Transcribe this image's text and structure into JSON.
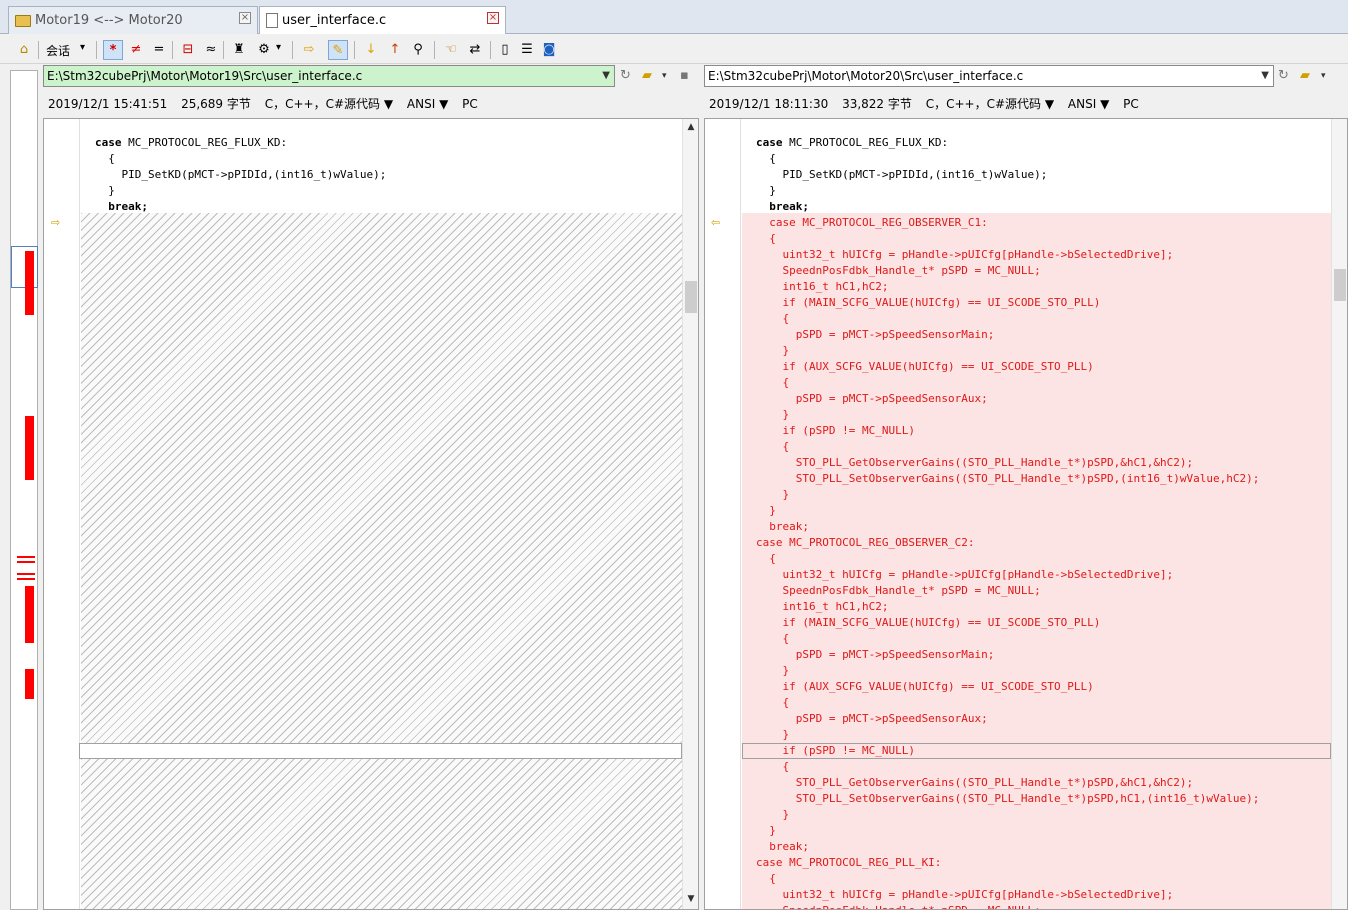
{
  "tabs": [
    {
      "label": "Motor19 <--> Motor20",
      "close": "×"
    },
    {
      "label": "user_interface.c",
      "close": "×"
    }
  ],
  "toolbar": {
    "session_label": "会话",
    "session_arrow": "▾",
    "show_all": "*",
    "show_diff": "≠",
    "show_same": "=",
    "align": "≈"
  },
  "left": {
    "path": "E:\\Stm32cubePrj\\Motor\\Motor19\\Src\\user_interface.c",
    "info": [
      "2019/12/1 15:41:51",
      "25,689 字节",
      "C，C++，C#源代码 ▼",
      "ANSI ▼",
      "PC"
    ],
    "lines": [
      {
        "t": "case MC_PROTOCOL_REG_FLUX_KD:"
      },
      {
        "t": "  {"
      },
      {
        "t": "    PID_SetKD(pMCT->pPIDId,(int16_t)wValue);"
      },
      {
        "t": "  }"
      },
      {
        "t": "  break;"
      }
    ]
  },
  "right": {
    "path": "E:\\Stm32cubePrj\\Motor\\Motor20\\Src\\user_interface.c",
    "info": [
      "2019/12/1 18:11:30",
      "33,822 字节",
      "C，C++，C#源代码 ▼",
      "ANSI ▼",
      "PC"
    ],
    "lines": [
      {
        "t": "case MC_PROTOCOL_REG_FLUX_KD:"
      },
      {
        "t": "  {"
      },
      {
        "t": "    PID_SetKD(pMCT->pPIDId,(int16_t)wValue);"
      },
      {
        "t": "  }"
      },
      {
        "t": "  break;"
      },
      {
        "t": "  case MC_PROTOCOL_REG_OBSERVER_C1:"
      },
      {
        "t": "  {"
      },
      {
        "t": "    uint32_t hUICfg = pHandle->pUICfg[pHandle->bSelectedDrive];"
      },
      {
        "t": "    SpeednPosFdbk_Handle_t* pSPD = MC_NULL;"
      },
      {
        "t": "    int16_t hC1,hC2;"
      },
      {
        "t": "    if (MAIN_SCFG_VALUE(hUICfg) == UI_SCODE_STO_PLL)"
      },
      {
        "t": "    {"
      },
      {
        "t": "      pSPD = pMCT->pSpeedSensorMain;"
      },
      {
        "t": "    }"
      },
      {
        "t": "    if (AUX_SCFG_VALUE(hUICfg) == UI_SCODE_STO_PLL)"
      },
      {
        "t": "    {"
      },
      {
        "t": "      pSPD = pMCT->pSpeedSensorAux;"
      },
      {
        "t": "    }"
      },
      {
        "t": "    if (pSPD != MC_NULL)"
      },
      {
        "t": "    {"
      },
      {
        "t": "      STO_PLL_GetObserverGains((STO_PLL_Handle_t*)pSPD,&hC1,&hC2);"
      },
      {
        "t": "      STO_PLL_SetObserverGains((STO_PLL_Handle_t*)pSPD,(int16_t)wValue,hC2);"
      },
      {
        "t": "    }"
      },
      {
        "t": "  }"
      },
      {
        "t": "  break;"
      },
      {
        "t": "case MC_PROTOCOL_REG_OBSERVER_C2:"
      },
      {
        "t": "  {"
      },
      {
        "t": "    uint32_t hUICfg = pHandle->pUICfg[pHandle->bSelectedDrive];"
      },
      {
        "t": "    SpeednPosFdbk_Handle_t* pSPD = MC_NULL;"
      },
      {
        "t": "    int16_t hC1,hC2;"
      },
      {
        "t": "    if (MAIN_SCFG_VALUE(hUICfg) == UI_SCODE_STO_PLL)"
      },
      {
        "t": "    {"
      },
      {
        "t": "      pSPD = pMCT->pSpeedSensorMain;"
      },
      {
        "t": "    }"
      },
      {
        "t": "    if (AUX_SCFG_VALUE(hUICfg) == UI_SCODE_STO_PLL)"
      },
      {
        "t": "    {"
      },
      {
        "t": "      pSPD = pMCT->pSpeedSensorAux;"
      },
      {
        "t": "    }"
      },
      {
        "t": "    if (pSPD != MC_NULL)"
      },
      {
        "t": "    {"
      },
      {
        "t": "      STO_PLL_GetObserverGains((STO_PLL_Handle_t*)pSPD,&hC1,&hC2);"
      },
      {
        "t": "      STO_PLL_SetObserverGains((STO_PLL_Handle_t*)pSPD,hC1,(int16_t)wValue);"
      },
      {
        "t": "    }"
      },
      {
        "t": "  }"
      },
      {
        "t": "  break;"
      },
      {
        "t": "case MC_PROTOCOL_REG_PLL_KI:"
      },
      {
        "t": "  {"
      },
      {
        "t": "    uint32_t hUICfg = pHandle->pUICfg[pHandle->bSelectedDrive];"
      },
      {
        "t": "    SpeednPosFdbk_Handle_t* pSPD = MC_NULL;"
      }
    ]
  },
  "colors": {
    "diff_bg": "#fde4e4",
    "diff_text": "#e01818",
    "left_path_bg": "#ccf3cc",
    "overview_mark": "#ff0000"
  }
}
